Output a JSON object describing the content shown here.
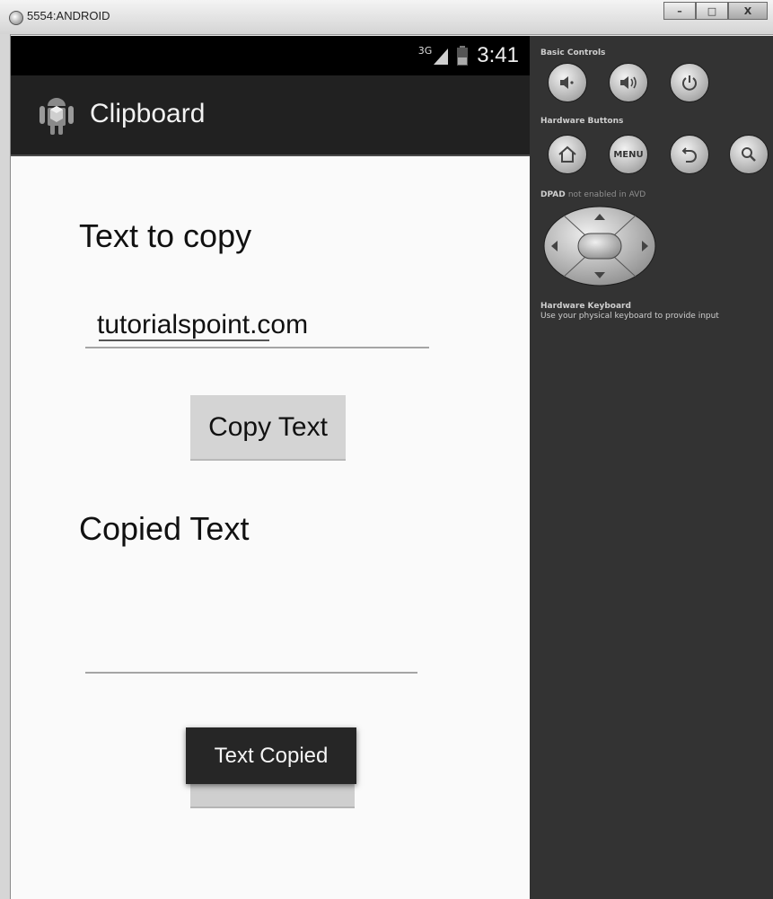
{
  "window": {
    "title": "5554:ANDROID",
    "buttons": [
      "–",
      "□",
      "X"
    ]
  },
  "device": {
    "status_bar": {
      "network": "3G",
      "time": "3:41"
    },
    "action_bar": {
      "title": "Clipboard"
    },
    "content": {
      "label_text_to_copy": "Text to copy",
      "input_text_to_copy": "tutorialspoint.com",
      "copy_button_label": "Copy Text",
      "label_copied_text": "Copied Text",
      "copied_text_value": "",
      "toast_message": "Text Copied"
    }
  },
  "controls_panel": {
    "basic_controls_title": "Basic Controls",
    "basic_controls": [
      "volume-down-icon",
      "volume-up-icon",
      "power-icon"
    ],
    "hardware_buttons_title": "Hardware Buttons",
    "hardware_buttons": [
      "home-icon",
      "MENU",
      "back-icon",
      "search-icon"
    ],
    "menu_label": "MENU",
    "dpad_title": "DPAD",
    "dpad_note": "not enabled in AVD",
    "keyboard_title": "Hardware Keyboard",
    "keyboard_note": "Use your physical keyboard to provide input"
  }
}
